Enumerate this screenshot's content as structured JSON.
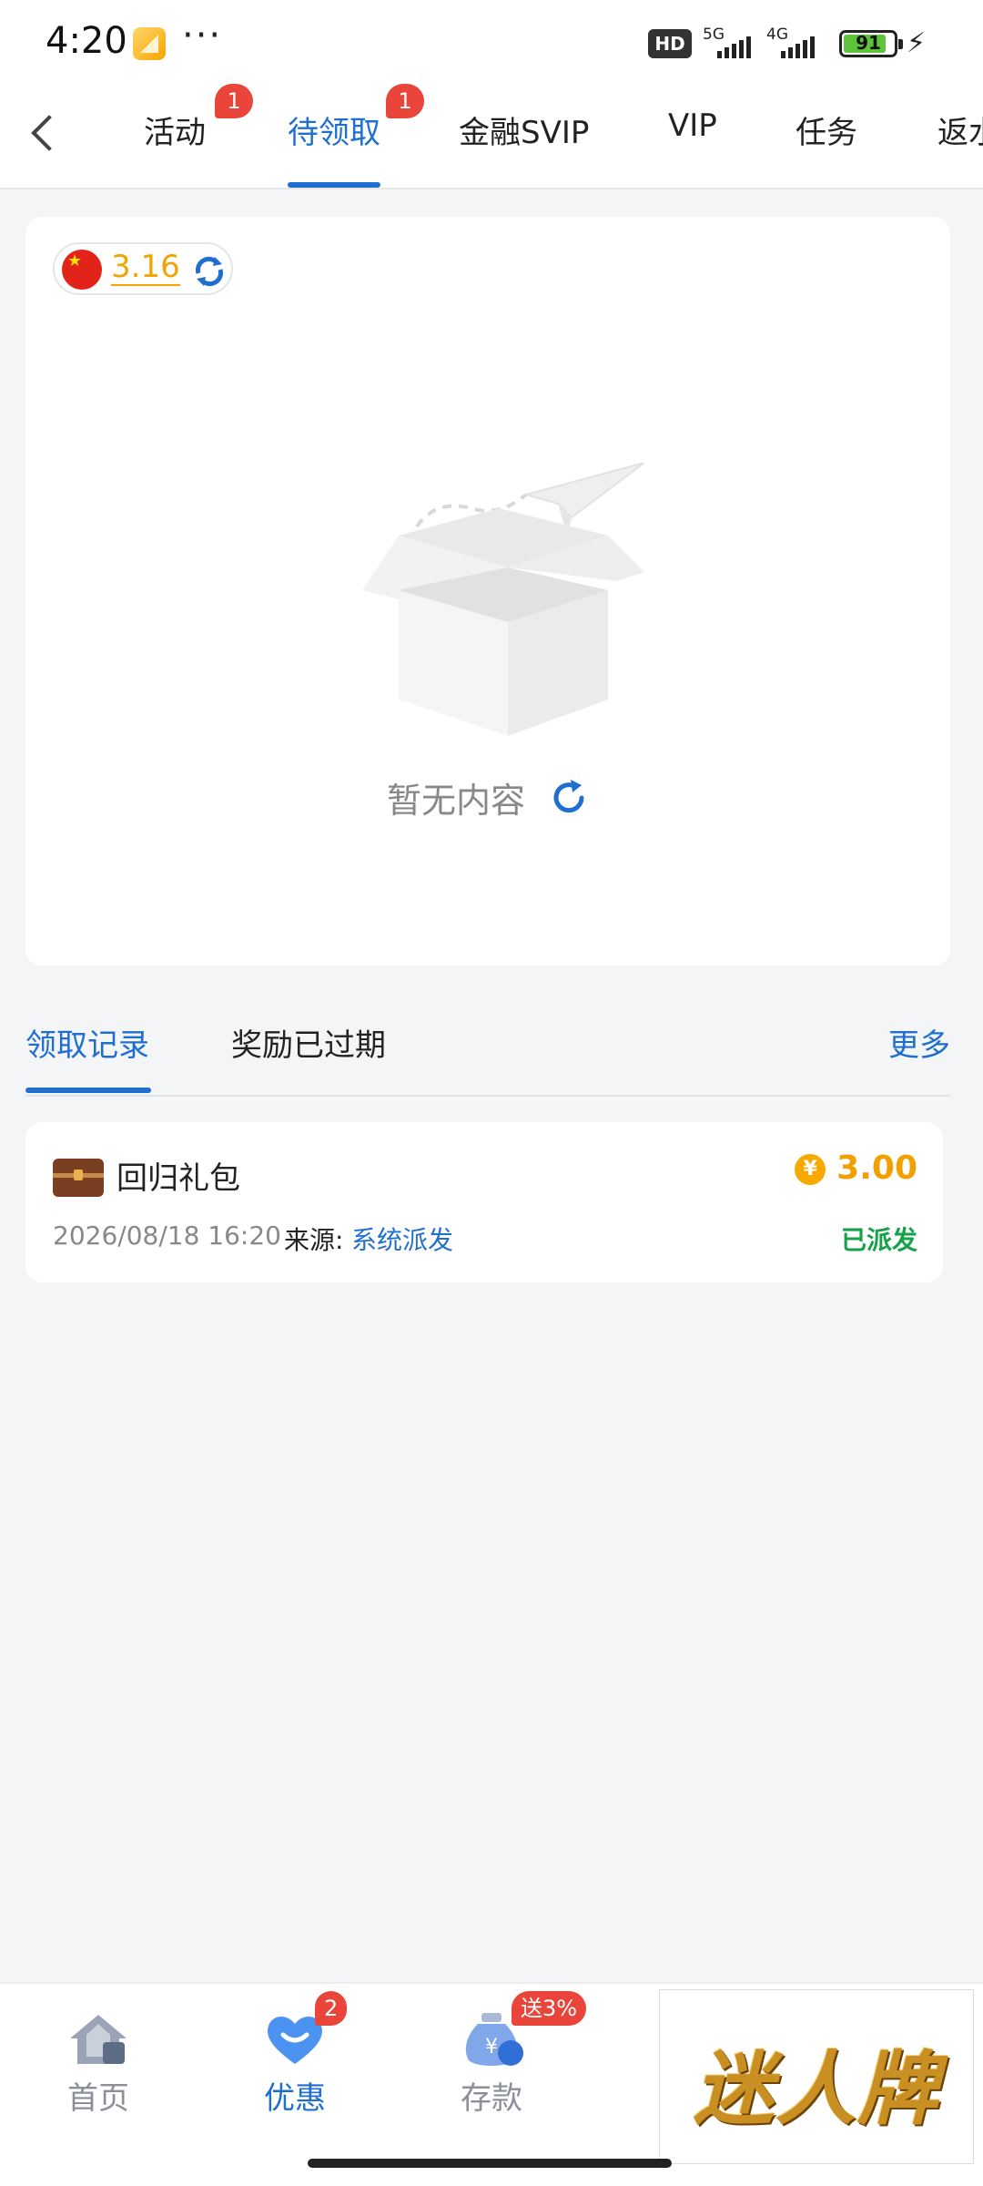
{
  "status_bar": {
    "time": "4:20",
    "dots": "···",
    "hd_label": "HD",
    "net1": "5G",
    "net2": "4G",
    "battery": "91",
    "app_icon": "gallery-app-icon",
    "charging_icon": "bolt-icon"
  },
  "header": {
    "back_icon": "chevron-left-icon",
    "tabs": [
      {
        "label": "活动",
        "badge": "1"
      },
      {
        "label": "待领取",
        "badge": "1",
        "active": true
      },
      {
        "label": "金融SVIP"
      },
      {
        "label": "VIP"
      },
      {
        "label": "任务"
      },
      {
        "label": "返水"
      }
    ]
  },
  "balance": {
    "flag_icon": "china-flag-icon",
    "value": "3.16",
    "refresh_icon": "refresh-icon"
  },
  "empty_state": {
    "illustration": "empty-box-icon",
    "text": "暂无内容",
    "refresh_icon": "refresh-icon"
  },
  "records_tabs": {
    "tabs": [
      {
        "label": "领取记录",
        "active": true
      },
      {
        "label": "奖励已过期"
      }
    ],
    "more": "更多"
  },
  "records": [
    {
      "icon": "treasure-chest-icon",
      "title": "回归礼包",
      "amount": "3.00",
      "coin_symbol": "¥",
      "date": "2026/08/18 16:20",
      "source_label": "来源:",
      "source": "系统派发",
      "status": "已派发"
    }
  ],
  "bottom_nav": {
    "items": [
      {
        "label": "首页",
        "icon": "home-icon"
      },
      {
        "label": "优惠",
        "icon": "heart-icon",
        "badge": "2",
        "active": true
      },
      {
        "label": "存款",
        "icon": "money-bag-icon",
        "badge": "送3%"
      }
    ],
    "ad_text": "迷人牌"
  },
  "colors": {
    "accent": "#1f6fd1",
    "badge": "#e9453b",
    "gold": "#f0a500",
    "success": "#16a24a"
  }
}
